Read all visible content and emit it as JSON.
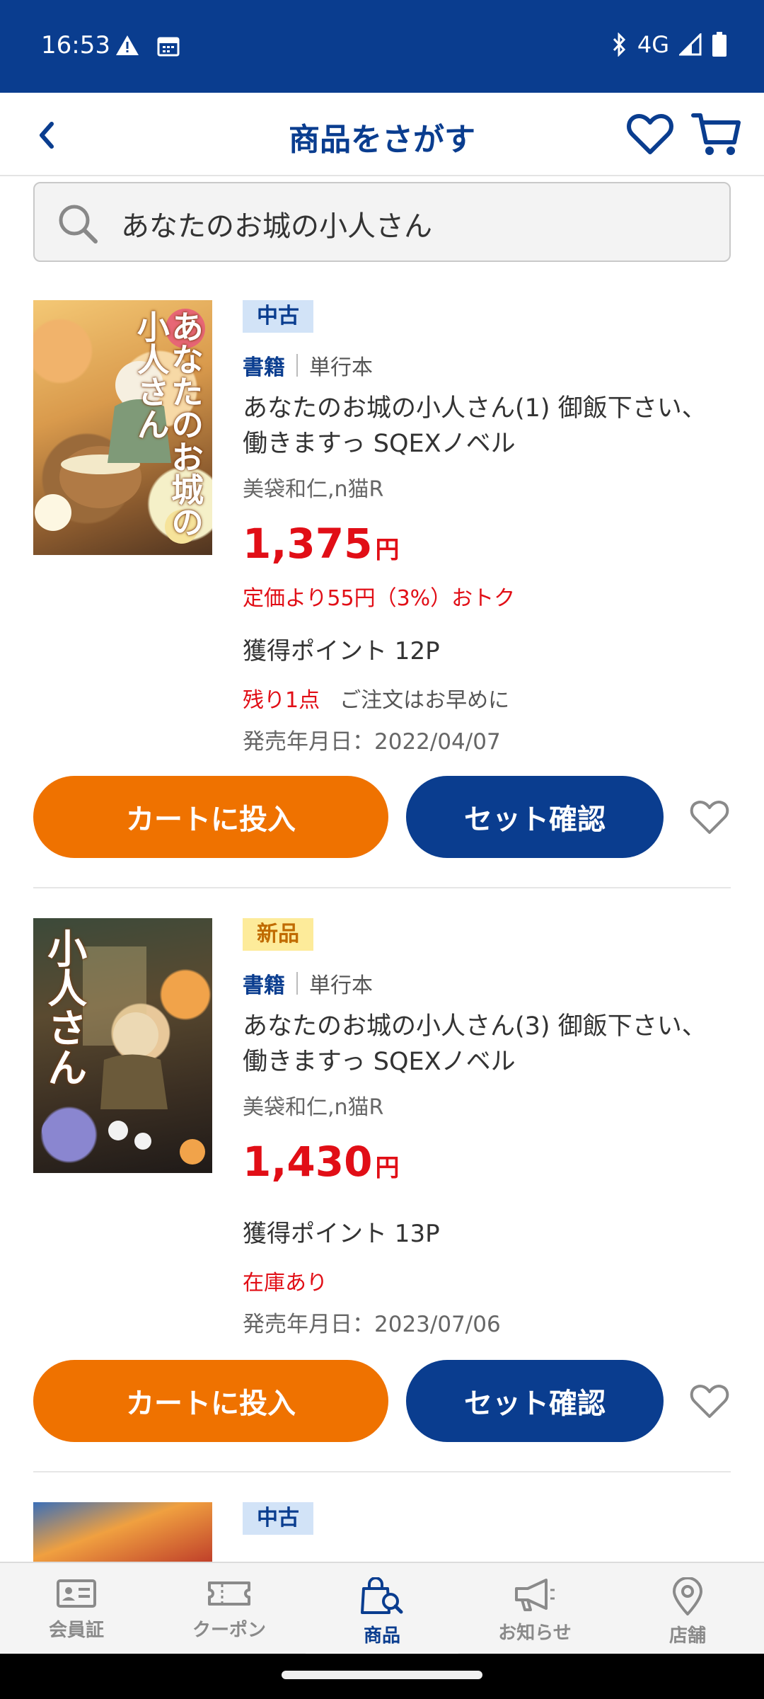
{
  "status_bar": {
    "time": "16:53",
    "network": "4G",
    "icons": [
      "warning-icon",
      "calendar-icon",
      "bluetooth-icon",
      "signal-icon",
      "battery-icon"
    ]
  },
  "header": {
    "title": "商品をさがす",
    "icons": [
      "back-chevron-icon",
      "heart-icon",
      "cart-icon"
    ]
  },
  "search": {
    "query": "あなたのお城の小人さん"
  },
  "products": [
    {
      "cover_title": "あなたのお城の小人さん",
      "condition": "中古",
      "category": "書籍",
      "format": "単行本",
      "title": "あなたのお城の小人さん(1) 御飯下さい、働きますっ SQEXノベル",
      "author": "美袋和仁,n猫R",
      "price": "1,375",
      "currency": "円",
      "discount": "定価より55円（3%）おトク",
      "points": "獲得ポイント 12P",
      "stock": "残り1点",
      "stock_note": "ご注文はお早めに",
      "release": "発売年月日：2022/04/07",
      "cart_button": "カートに投入",
      "set_button": "セット確認"
    },
    {
      "cover_title": "小人さん",
      "condition": "新品",
      "category": "書籍",
      "format": "単行本",
      "title": "あなたのお城の小人さん(3) 御飯下さい、働きますっ SQEXノベル",
      "author": "美袋和仁,n猫R",
      "price": "1,430",
      "currency": "円",
      "points": "獲得ポイント 13P",
      "stock": "在庫あり",
      "release": "発売年月日：2023/07/06",
      "cart_button": "カートに投入",
      "set_button": "セット確認"
    },
    {
      "condition": "中古"
    }
  ],
  "bottom_nav": [
    {
      "label": "会員証",
      "icon": "member-card-icon"
    },
    {
      "label": "クーポン",
      "icon": "coupon-icon"
    },
    {
      "label": "商品",
      "icon": "product-search-icon",
      "active": true
    },
    {
      "label": "お知らせ",
      "icon": "megaphone-icon"
    },
    {
      "label": "店舗",
      "icon": "location-pin-icon"
    }
  ],
  "colors": {
    "brand_blue": "#0a3d8f",
    "cart_orange": "#ef7200",
    "price_red": "#e10e16"
  }
}
